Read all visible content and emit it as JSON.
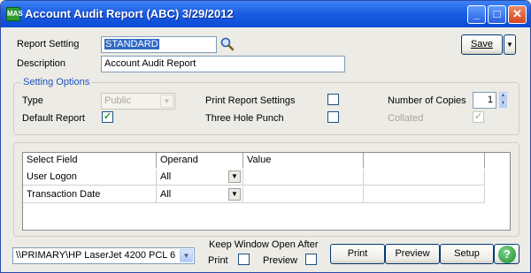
{
  "window": {
    "title": "Account Audit Report (ABC) 3/29/2012",
    "app_icon_text": "MAS"
  },
  "report": {
    "setting_label": "Report Setting",
    "setting_value": "STANDARD",
    "description_label": "Description",
    "description_value": "Account Audit Report",
    "save_label": "Save"
  },
  "setting_options": {
    "group_label": "Setting Options",
    "type_label": "Type",
    "type_value": "Public",
    "default_report_label": "Default Report",
    "default_report_checked": true,
    "print_settings_label": "Print Report Settings",
    "print_settings_checked": false,
    "three_hole_label": "Three Hole Punch",
    "three_hole_checked": false,
    "copies_label": "Number of Copies",
    "copies_value": "1",
    "collated_label": "Collated",
    "collated_checked": true
  },
  "grid": {
    "columns": [
      "Select Field",
      "Operand",
      "Value"
    ],
    "rows": [
      {
        "field": "User Logon",
        "operand": "All",
        "value": ""
      },
      {
        "field": "Transaction Date",
        "operand": "All",
        "value": ""
      }
    ]
  },
  "footer": {
    "printer": "\\\\PRIMARY\\HP LaserJet 4200 PCL 6",
    "keep_open_label": "Keep Window Open After",
    "print_check_label": "Print",
    "preview_check_label": "Preview",
    "print_button": "Print",
    "preview_button": "Preview",
    "setup_button": "Setup"
  },
  "colors": {
    "titlebar": "#0a49d6",
    "group_title": "#2052c6",
    "selection": "#316ac5"
  }
}
